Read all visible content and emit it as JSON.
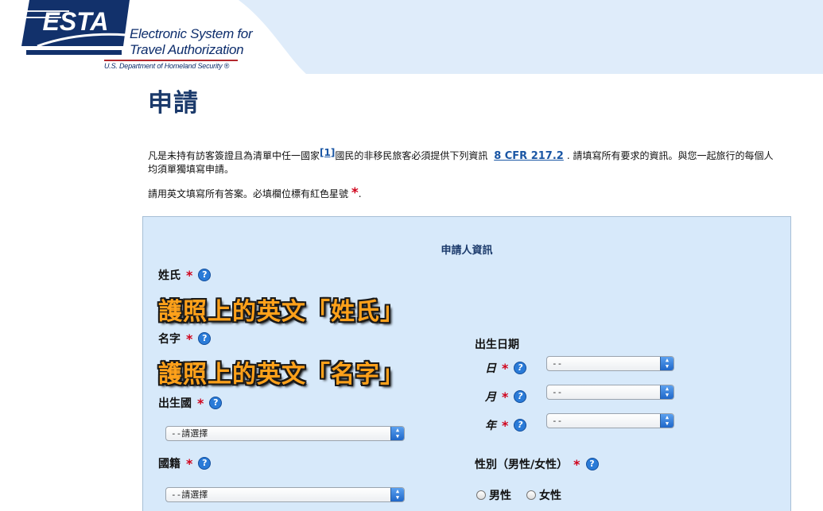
{
  "header": {
    "logo_mark": "ESTA",
    "logo_line1": "Electronic System for",
    "logo_line2": "Travel Authorization",
    "logo_dept": "U.S. Department of Homeland Security ®"
  },
  "page": {
    "title": "申請",
    "intro_a": "凡是未持有訪客簽證且為清單中任一國家",
    "intro_ref": "[1]",
    "intro_b": "國民的非移民旅客必須提供下列資訊",
    "intro_cfr": "8 CFR 217.2",
    "intro_c": ". 請填寫所有要求的資訊。與您一起旅行的每個人均須單獨填寫申請。",
    "note_text": "請用英文填寫所有答案。必填欄位標有紅色星號",
    "note_end": "."
  },
  "form": {
    "section_title": "申請人資訊",
    "required_mark": "*",
    "help_glyph": "?",
    "surname_label": "姓氏",
    "surname_callout": "護照上的英文「姓氏」",
    "given_label": "名字",
    "given_callout": "護照上的英文「名字」",
    "birth_country_label": "出生國",
    "birth_country_value": "--請選擇",
    "nationality_label": "國籍",
    "nationality_value": "--請選擇",
    "dob_label": "出生日期",
    "dob_day_label": "日",
    "dob_month_label": "月",
    "dob_year_label": "年",
    "dob_day_value": "--",
    "dob_month_value": "--",
    "dob_year_value": "--",
    "gender_label": "性別（男性/女性）",
    "gender_male": "男性",
    "gender_female": "女性"
  },
  "colors": {
    "brand_navy": "#0d2d6c",
    "panel_bg": "#d7e9fa",
    "required_red": "#d0021b",
    "callout_orange": "#ffa11a"
  }
}
